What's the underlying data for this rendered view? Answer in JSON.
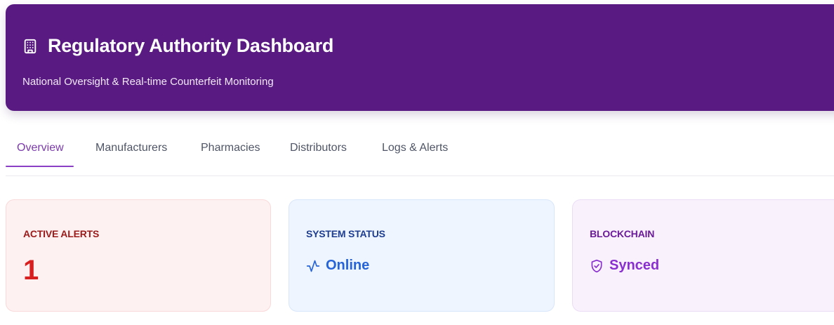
{
  "header": {
    "icon": "building-icon",
    "title": "Regulatory Authority Dashboard",
    "subtitle": "National Oversight & Real-time Counterfeit Monitoring",
    "background_color": "#591b82"
  },
  "tabs": [
    {
      "label": "Overview",
      "active": true
    },
    {
      "label": "Manufacturers",
      "active": false
    },
    {
      "label": "Pharmacies",
      "active": false
    },
    {
      "label": "Distributors",
      "active": false
    },
    {
      "label": "Logs & Alerts",
      "active": false
    }
  ],
  "cards": {
    "active_alerts": {
      "label": "ACTIVE ALERTS",
      "value": "1",
      "accent_color": "#d71f1f"
    },
    "system_status": {
      "label": "SYSTEM STATUS",
      "icon": "activity-icon",
      "value": "Online",
      "accent_color": "#2563d9"
    },
    "blockchain": {
      "label": "BLOCKCHAIN",
      "icon": "shield-check-icon",
      "value": "Synced",
      "accent_color": "#8a2fcf"
    }
  },
  "theme": {
    "accent": "#7c3aad"
  }
}
